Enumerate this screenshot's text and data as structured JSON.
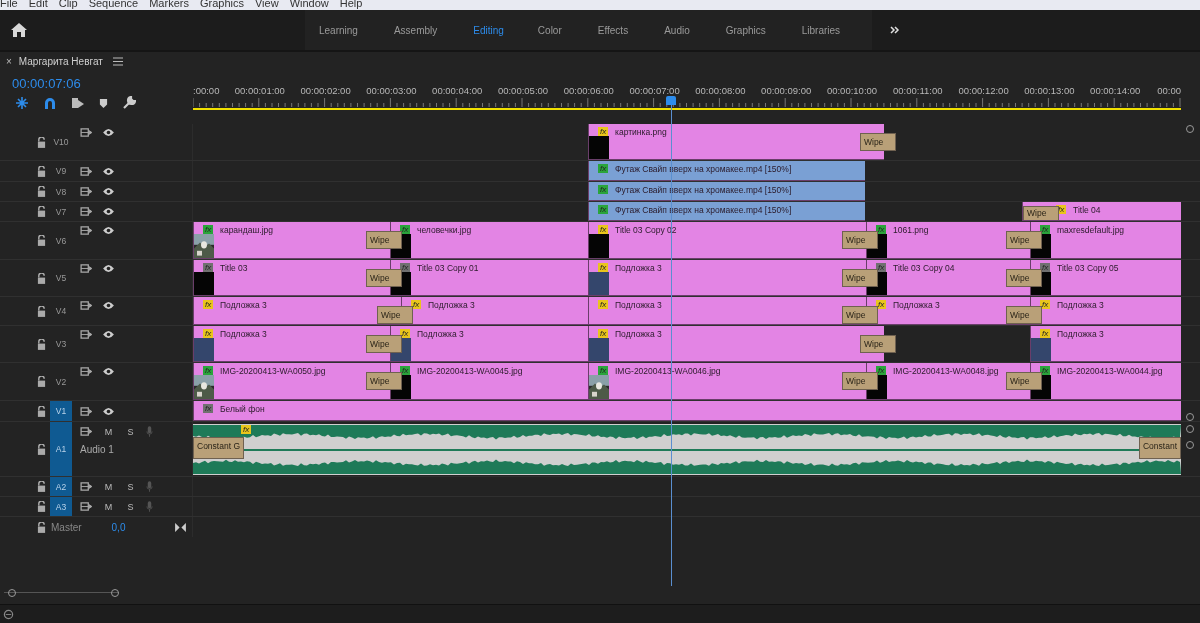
{
  "menu": [
    "File",
    "Edit",
    "Clip",
    "Sequence",
    "Markers",
    "Graphics",
    "View",
    "Window",
    "Help"
  ],
  "workspaces": [
    {
      "label": "Learning",
      "selected": false
    },
    {
      "label": "Assembly",
      "selected": false
    },
    {
      "label": "Editing",
      "selected": true
    },
    {
      "label": "Color",
      "selected": false
    },
    {
      "label": "Effects",
      "selected": false
    },
    {
      "label": "Audio",
      "selected": false
    },
    {
      "label": "Graphics",
      "selected": false
    },
    {
      "label": "Libraries",
      "selected": false
    }
  ],
  "sequence": {
    "close": "×",
    "title": "Маргарита Невгат",
    "timecode": "00:00:07:06"
  },
  "ruler": {
    "ticks": [
      ":00:00",
      "00:00:01:00",
      "00:00:02:00",
      "00:00:03:00",
      "00:00:04:00",
      "00:00:05:00",
      "00:00:06:00",
      "00:00:07:00",
      "00:00:08:00",
      "00:00:09:00",
      "00:00:10:00",
      "00:00:11:00",
      "00:00:12:00",
      "00:00:13:00",
      "00:00:14:00",
      "00:00"
    ]
  },
  "tracks": [
    {
      "name": "V10",
      "kind": "video",
      "targeted": false,
      "clips": [
        {
          "name": "картинка.png",
          "badge": {
            "label": "fx",
            "kind": "intrinsic"
          },
          "color": "#e384e4",
          "thumbnail": {
            "kind": "black"
          },
          "transition_out": "Wipe"
        }
      ]
    },
    {
      "name": "V9",
      "kind": "video",
      "targeted": false,
      "clips": [
        {
          "name": "Футаж Свайп вверх на хромакее.mp4 [150%]",
          "badge": {
            "label": "fx",
            "kind": "applied"
          },
          "color": "#7aa0d4"
        }
      ]
    },
    {
      "name": "V8",
      "kind": "video",
      "targeted": false,
      "clips": [
        {
          "name": "Футаж Свайп вверх на хромакее.mp4 [150%]",
          "badge": {
            "label": "fx",
            "kind": "applied"
          },
          "color": "#7aa0d4"
        }
      ]
    },
    {
      "name": "V7",
      "kind": "video",
      "targeted": false,
      "clips": [
        {
          "name": "Футаж Свайп вверх на хромакее.mp4 [150%]",
          "badge": {
            "label": "fx",
            "kind": "applied"
          },
          "color": "#7aa0d4"
        },
        {
          "name": "Title 04",
          "badge": {
            "label": "fx",
            "kind": "intrinsic"
          },
          "color": "#e384e4",
          "transition_in": "Wipe"
        }
      ]
    },
    {
      "name": "V6",
      "kind": "video",
      "targeted": false,
      "clips": [
        {
          "name": "карандаш.jpg",
          "badge": {
            "label": "fx",
            "kind": "applied"
          },
          "color": "#e384e4",
          "transition_out": "Wipe"
        },
        {
          "name": "человечки.jpg",
          "badge": {
            "label": "fx",
            "kind": "applied"
          },
          "color": "#e384e4",
          "thumbnail": {
            "kind": "black"
          }
        },
        {
          "name": "Title 03 Copy 02",
          "badge": {
            "label": "fx",
            "kind": "intrinsic"
          },
          "color": "#e384e4",
          "thumbnail": {
            "kind": "black"
          },
          "transition_out": "Wipe"
        },
        {
          "name": "1061.png",
          "badge": {
            "label": "fx",
            "kind": "applied"
          },
          "color": "#e384e4",
          "thumbnail": {
            "kind": "black"
          },
          "transition_out": "Wipe"
        },
        {
          "name": "maxresdefault.jpg",
          "badge": {
            "label": "fx",
            "kind": "applied"
          },
          "color": "#e384e4",
          "thumbnail": {
            "kind": "black"
          }
        }
      ]
    },
    {
      "name": "V5",
      "kind": "video",
      "targeted": false,
      "clips": [
        {
          "name": "Title 03",
          "badge": {
            "label": "fx",
            "kind": "none"
          },
          "color": "#e384e4",
          "thumbnail": {
            "kind": "black"
          },
          "transition_out": "Wipe"
        },
        {
          "name": "Title 03 Copy 01",
          "badge": {
            "label": "fx",
            "kind": "none"
          },
          "color": "#e384e4",
          "thumbnail": {
            "kind": "black"
          }
        },
        {
          "name": "Подложка 3",
          "badge": {
            "label": "fx",
            "kind": "intrinsic"
          },
          "color": "#e384e4",
          "thumbnail": {
            "kind": "matte"
          },
          "transition_out": "Wipe"
        },
        {
          "name": "Title 03 Copy 04",
          "badge": {
            "label": "fx",
            "kind": "none"
          },
          "color": "#e384e4",
          "thumbnail": {
            "kind": "black"
          },
          "transition_out": "Wipe"
        },
        {
          "name": "Title 03 Copy 05",
          "badge": {
            "label": "fx",
            "kind": "none"
          },
          "color": "#e384e4",
          "thumbnail": {
            "kind": "black"
          }
        }
      ]
    },
    {
      "name": "V4",
      "kind": "video",
      "targeted": false,
      "clips": [
        {
          "name": "Подложка 3",
          "badge": {
            "label": "fx",
            "kind": "intrinsic"
          },
          "color": "#e384e4",
          "transition_out": "Wipe"
        },
        {
          "name": "Подложка 3",
          "badge": {
            "label": "fx",
            "kind": "intrinsic"
          },
          "color": "#e384e4"
        },
        {
          "name": "Подложка 3",
          "badge": {
            "label": "fx",
            "kind": "intrinsic"
          },
          "color": "#e384e4",
          "transition_out": "Wipe"
        },
        {
          "name": "Подложка 3",
          "badge": {
            "label": "fx",
            "kind": "intrinsic"
          },
          "color": "#e384e4",
          "transition_out": "Wipe"
        },
        {
          "name": "Подложка 3",
          "badge": {
            "label": "fx",
            "kind": "intrinsic"
          },
          "color": "#e384e4"
        }
      ]
    },
    {
      "name": "V3",
      "kind": "video",
      "targeted": false,
      "clips": [
        {
          "name": "Подложка 3",
          "badge": {
            "label": "fx",
            "kind": "intrinsic"
          },
          "color": "#e384e4",
          "thumbnail": {
            "kind": "matte"
          },
          "transition_out": "Wipe"
        },
        {
          "name": "Подложка 3",
          "badge": {
            "label": "fx",
            "kind": "intrinsic"
          },
          "color": "#e384e4",
          "thumbnail": {
            "kind": "matte"
          }
        },
        {
          "name": "Подложка 3",
          "badge": {
            "label": "fx",
            "kind": "intrinsic"
          },
          "color": "#e384e4",
          "thumbnail": {
            "kind": "matte"
          },
          "transition_out": "Wipe"
        },
        {
          "name": "Подложка 3",
          "badge": {
            "label": "fx",
            "kind": "intrinsic"
          },
          "color": "#e384e4",
          "thumbnail": {
            "kind": "matte"
          }
        }
      ]
    },
    {
      "name": "V2",
      "kind": "video",
      "targeted": false,
      "clips": [
        {
          "name": "IMG-20200413-WA0050.jpg",
          "badge": {
            "label": "fx",
            "kind": "applied"
          },
          "color": "#e384e4",
          "transition_out": "Wipe"
        },
        {
          "name": "IMG-20200413-WA0045.jpg",
          "badge": {
            "label": "fx",
            "kind": "applied"
          },
          "color": "#e384e4",
          "thumbnail": {
            "kind": "black"
          }
        },
        {
          "name": "IMG-20200413-WA0046.jpg",
          "badge": {
            "label": "fx",
            "kind": "applied"
          },
          "color": "#e384e4",
          "transition_out": "Wipe"
        },
        {
          "name": "IMG-20200413-WA0048.jpg",
          "badge": {
            "label": "fx",
            "kind": "applied"
          },
          "color": "#e384e4",
          "thumbnail": {
            "kind": "black"
          },
          "transition_out": "Wipe"
        },
        {
          "name": "IMG-20200413-WA0044.jpg",
          "badge": {
            "label": "fx",
            "kind": "applied"
          },
          "color": "#e384e4",
          "thumbnail": {
            "kind": "black"
          }
        }
      ]
    },
    {
      "name": "V1",
      "kind": "video",
      "targeted": true,
      "clips": [
        {
          "name": "Белый фон",
          "badge": {
            "label": "fx",
            "kind": "none"
          },
          "color": "#e384e4"
        }
      ]
    },
    {
      "name": "A1",
      "kind": "audio",
      "targeted": true,
      "title": "Audio 1",
      "mute": "M",
      "solo": "S",
      "clips": [
        {
          "badge": {
            "label": "fx",
            "kind": "intrinsic"
          },
          "transition_in": "Constant G",
          "transition_out": "Constant"
        }
      ]
    },
    {
      "name": "A2",
      "kind": "audio",
      "targeted": true,
      "mute": "M",
      "solo": "S"
    },
    {
      "name": "A3",
      "kind": "audio",
      "targeted": true,
      "mute": "M",
      "solo": "S"
    }
  ],
  "master": {
    "label": "Master",
    "value": "0,0"
  }
}
